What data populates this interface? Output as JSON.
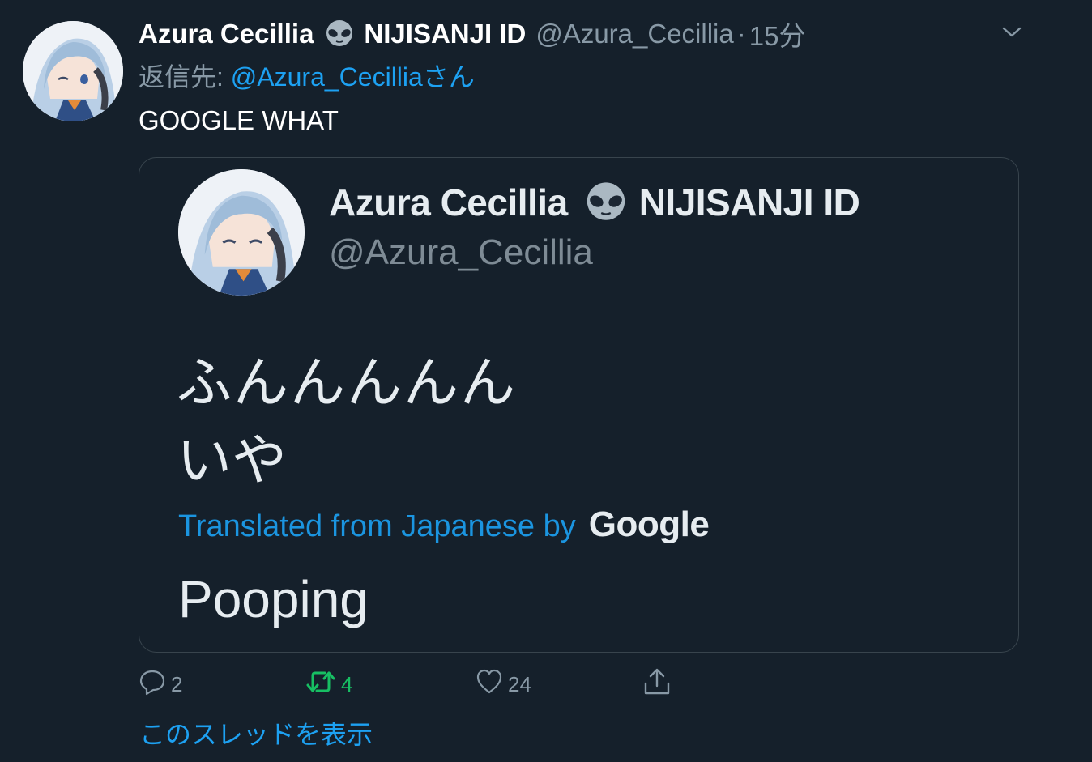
{
  "tweet": {
    "display_name": "Azura Cecillia",
    "name_suffix": "NIJISANJI ID",
    "handle": "@Azura_Cecillia",
    "separator": "·",
    "timestamp": "15分",
    "reply_prefix": "返信先: ",
    "reply_mention": "@Azura_Cecilliaさん",
    "text": "GOOGLE WHAT",
    "icons": {
      "emoji": "alien-icon",
      "menu": "chevron-down-icon"
    }
  },
  "quoted_image": {
    "display_name": "Azura Cecillia",
    "name_suffix": "NIJISANJI ID",
    "handle": "@Azura_Cecillia",
    "text_line_1": "ふんんんんん",
    "text_line_2": "いや",
    "translated_label": "Translated from Japanese by",
    "translator": "Google",
    "translation": "Pooping"
  },
  "actions": {
    "reply_count": "2",
    "retweet_count": "4",
    "like_count": "24",
    "share_label": ""
  },
  "show_thread": "このスレッドを表示",
  "colors": {
    "background": "#15202b",
    "text": "#ffffff",
    "secondary": "#8899a6",
    "accent": "#1da1f2",
    "retweet_active": "#17bf63",
    "border": "#38444d"
  }
}
